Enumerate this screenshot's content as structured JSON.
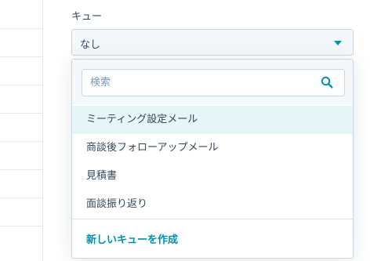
{
  "queue": {
    "label": "キュー",
    "selected_value": "なし",
    "search_placeholder": "検索",
    "options": [
      {
        "label": "ミーティング設定メール",
        "highlighted": true
      },
      {
        "label": "商談後フォローアップメール",
        "highlighted": false
      },
      {
        "label": "見積書",
        "highlighted": false
      },
      {
        "label": "面談振り返り",
        "highlighted": false
      }
    ],
    "create_label": "新しいキューを作成"
  },
  "colors": {
    "accent": "#0091ae",
    "highlight_bg": "#e5f5f8",
    "text": "#33475b",
    "border": "#cbd6e2"
  }
}
